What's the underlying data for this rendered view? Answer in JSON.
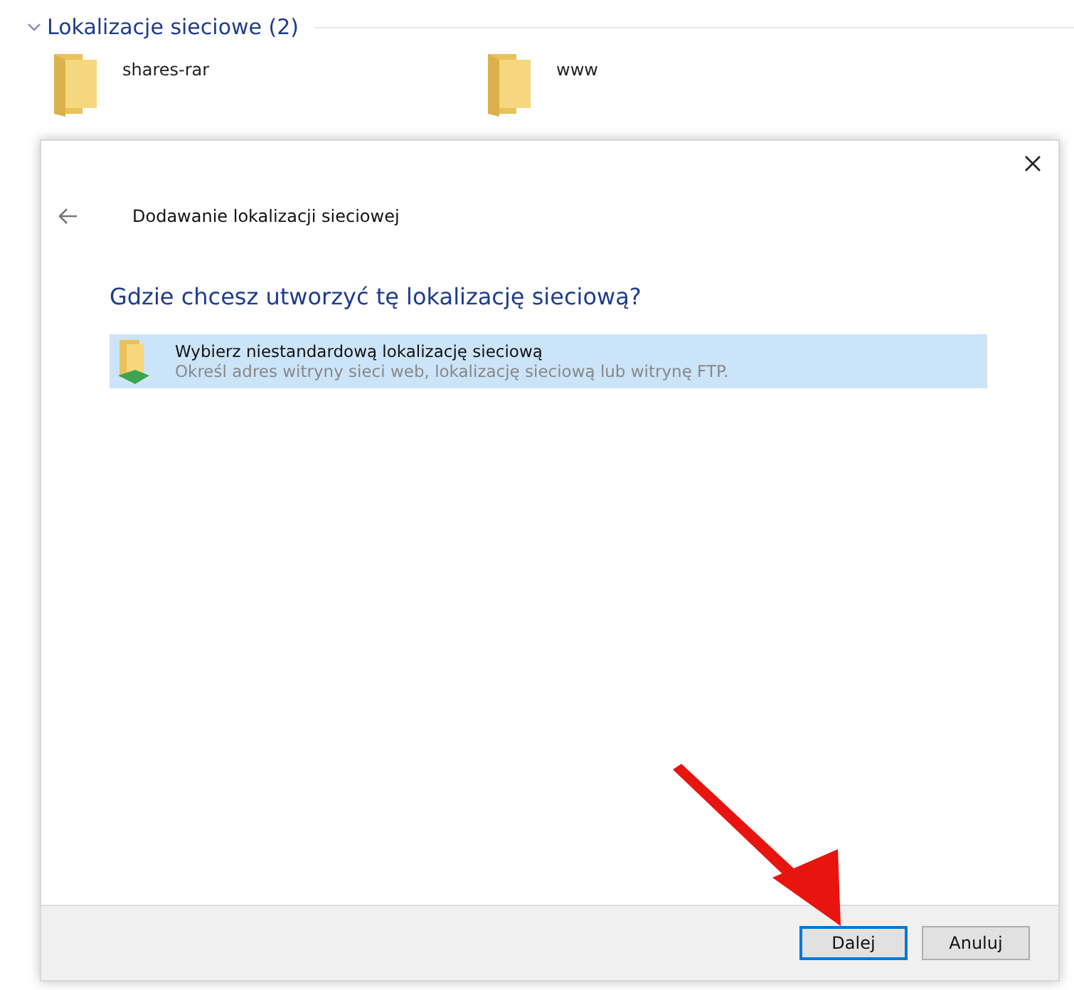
{
  "group": {
    "title": "Lokalizacje sieciowe (2)",
    "expanded": true,
    "items": [
      {
        "name": "shares-rar"
      },
      {
        "name": "www"
      }
    ]
  },
  "dialog": {
    "title": "Dodawanie lokalizacji sieciowej",
    "heading": "Gdzie chcesz utworzyć tę lokalizację sieciową?",
    "options": [
      {
        "title": "Wybierz niestandardową lokalizację sieciową",
        "description": "Określ adres witryny sieci web, lokalizację sieciową lub witrynę FTP.",
        "selected": true
      }
    ],
    "buttons": [
      {
        "label": "Dalej",
        "default": true
      },
      {
        "label": "Anuluj",
        "default": false
      }
    ]
  }
}
